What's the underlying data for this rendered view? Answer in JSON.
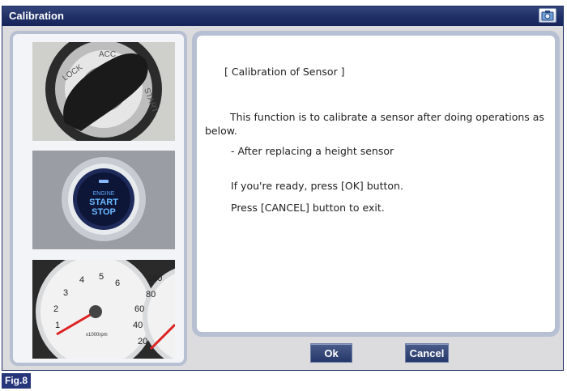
{
  "window": {
    "title": "Calibration"
  },
  "message": {
    "title": "[ Calibration of Sensor ]",
    "body": "This function is to calibrate a sensor after doing operations as below.",
    "bullet": "- After replacing a height sensor",
    "ready": "If you're ready, press [OK] button.",
    "exit": "Press [CANCEL] button to exit."
  },
  "buttons": {
    "ok_label": "Ok",
    "cancel_label": "Cancel"
  },
  "figure_label": "Fig.8",
  "icons": [
    "camera-icon",
    "ignition-key-photo",
    "engine-start-stop-photo",
    "instrument-cluster-photo"
  ],
  "colors": {
    "titlebar": "#1f2f66",
    "panel_border": "#b7bfd2",
    "button": "#26386a",
    "fig_label_bg": "#27357b"
  }
}
